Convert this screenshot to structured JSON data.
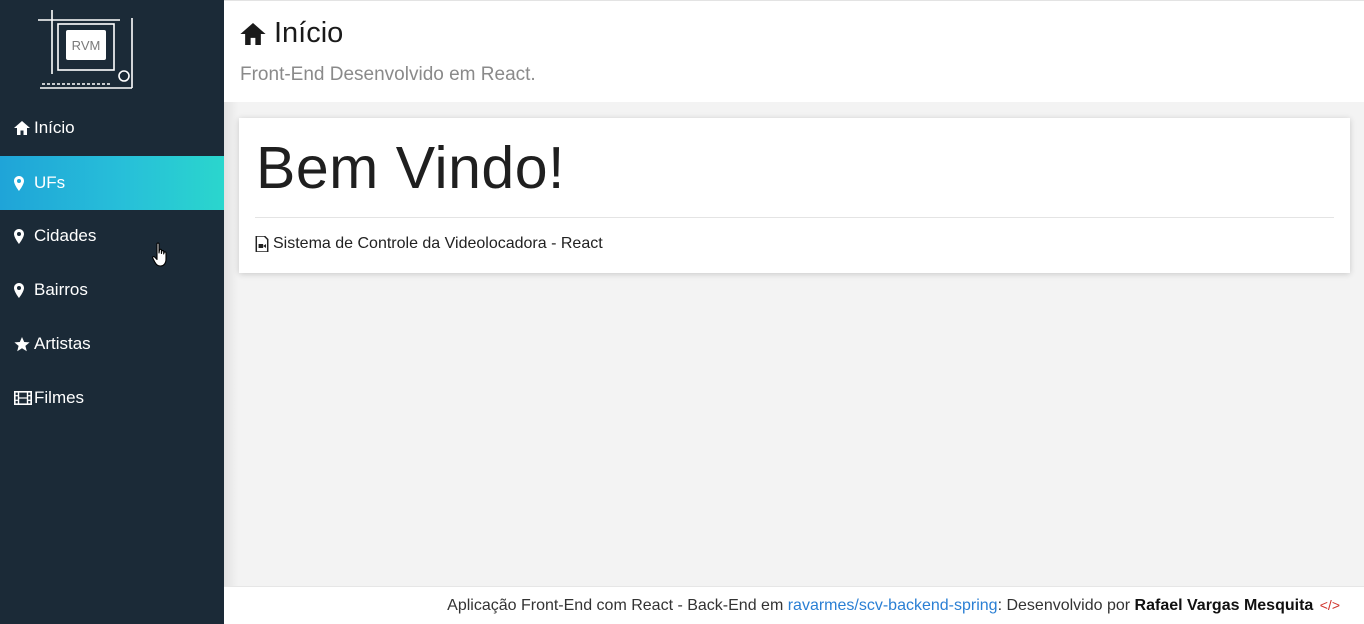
{
  "sidebar": {
    "logo_text": "RVM",
    "items": [
      {
        "label": "Início",
        "icon": "home-icon",
        "active": false
      },
      {
        "label": "UFs",
        "icon": "map-marker-icon",
        "active": true
      },
      {
        "label": "Cidades",
        "icon": "map-marker-icon",
        "active": false
      },
      {
        "label": "Bairros",
        "icon": "map-marker-icon",
        "active": false
      },
      {
        "label": "Artistas",
        "icon": "star-icon",
        "active": false
      },
      {
        "label": "Filmes",
        "icon": "film-icon",
        "active": false
      }
    ]
  },
  "header": {
    "title": "Início",
    "subtitle": "Front-End Desenvolvido em React."
  },
  "card": {
    "heading": "Bem Vindo!",
    "text": "Sistema de Controle da Videolocadora - React"
  },
  "footer": {
    "prefix": "Aplicação Front-End com React - Back-End em ",
    "link": "ravarmes/scv-backend-spring",
    "middle": ": Desenvolvido por ",
    "author": "Rafael Vargas Mesquita",
    "code_icon": "</>"
  },
  "colors": {
    "sidebar_bg": "#1b2a37",
    "active_gradient_start": "#1fa4d8",
    "active_gradient_end": "#2ad6cd",
    "link": "#2a7fd4",
    "code_icon": "#d0342c"
  }
}
